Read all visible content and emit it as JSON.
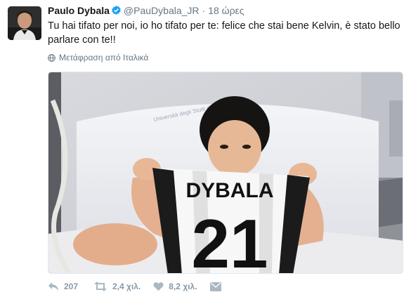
{
  "tweet": {
    "author_name": "Paulo Dybala",
    "handle": "@PauDybala_JR",
    "separator": "·",
    "timestamp": "18 ώρες",
    "text": "Tu hai tifato per noi, io ho tifato per te: felice che stai bene Kelvin, è stato bello parlare con te!!",
    "translate_label": "Μετάφραση από Ιταλικά"
  },
  "media": {
    "jersey_name": "DYBALA",
    "jersey_number": "21",
    "pillow_print": "Università degli Studi di Torino"
  },
  "actions": {
    "reply_count": "207",
    "retweet_count": "2,4 χιλ.",
    "like_count": "8,2 χιλ."
  },
  "colors": {
    "verified": "#1da1f2",
    "text": "#14171a",
    "secondary": "#657786",
    "action_icons": "#aab8c2"
  }
}
